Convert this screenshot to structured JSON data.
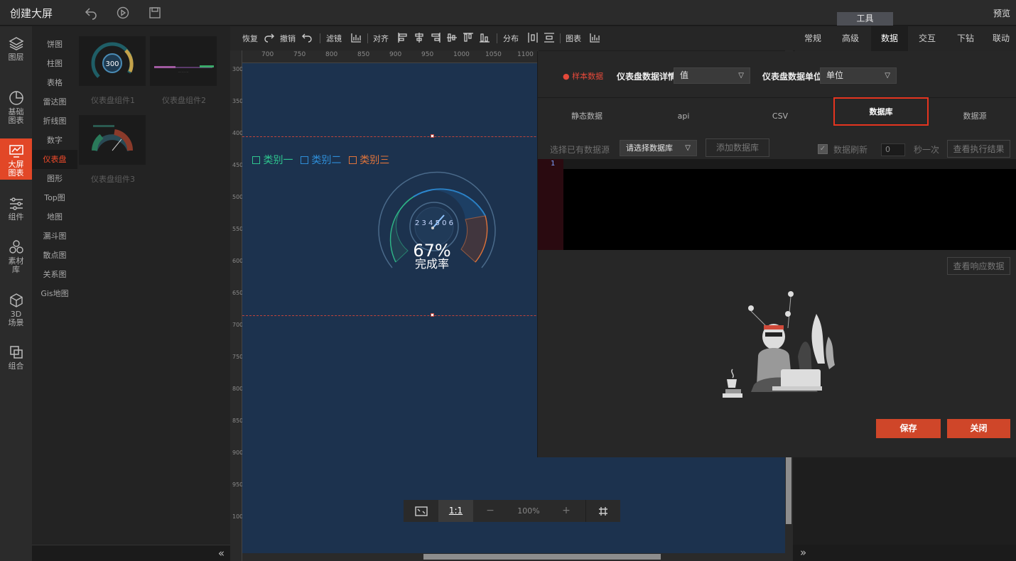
{
  "app": {
    "title": "创建大屏",
    "preview": "预览",
    "tools_tab": "工具"
  },
  "leftnav": [
    {
      "label": "图层",
      "icon": "layers-icon"
    },
    {
      "label": "基础图表",
      "icon": "pie-chart-icon"
    },
    {
      "label": "大屏图表",
      "icon": "screen-chart-icon",
      "active": true
    },
    {
      "label": "组件",
      "icon": "sliders-icon"
    },
    {
      "label": "素材库",
      "icon": "hexagons-icon"
    },
    {
      "label": "3D场景",
      "icon": "cube-icon"
    },
    {
      "label": "组合",
      "icon": "combine-icon"
    }
  ],
  "categories": [
    "饼图",
    "柱图",
    "表格",
    "雷达图",
    "折线图",
    "数字",
    "仪表盘",
    "图形",
    "Top图",
    "地图",
    "漏斗图",
    "散点图",
    "关系图",
    "Gis地图"
  ],
  "active_category": "仪表盘",
  "thumbnails": {
    "t1": {
      "label": "仪表盘组件1",
      "value": "300"
    },
    "t2": {
      "label": "仪表盘组件2"
    },
    "t3": {
      "label": "仪表盘组件3"
    }
  },
  "toolbar": {
    "restore": "恢复",
    "undo": "撤销",
    "filter": "滤镜",
    "align": "对齐",
    "distribute": "分布",
    "chart": "图表"
  },
  "ruler": {
    "top": [
      "700",
      "750",
      "800",
      "850",
      "900",
      "950",
      "1000",
      "1050",
      "1100"
    ],
    "left": [
      "300",
      "350",
      "400",
      "450",
      "500",
      "550",
      "600",
      "650",
      "700",
      "750",
      "800",
      "850",
      "900",
      "950",
      "1000"
    ]
  },
  "widget": {
    "legend": [
      "类别一",
      "类别二",
      "类别三"
    ],
    "legend_colors": [
      "#2ec58f",
      "#2e8ed8",
      "#e0743b"
    ],
    "center_digits": "2 3 4 5 0 6",
    "percent": "67%",
    "subtitle": "完成率"
  },
  "zoom": {
    "fit_label": "1:1",
    "level": "100%",
    "minus": "−",
    "plus": "+"
  },
  "right_tabs": [
    "常规",
    "高级",
    "数据",
    "交互",
    "下钻",
    "联动"
  ],
  "active_right_tab": "数据",
  "data_panel": {
    "sample_label": "● 样本数据",
    "detail_label": "仪表盘数据详情",
    "detail_value": "值",
    "unit_label": "仪表盘数据单位",
    "unit_value": "单位",
    "tabs": [
      "静态数据",
      "api",
      "CSV",
      "数据库",
      "数据源"
    ],
    "active_tab": "数据库",
    "existing_source_label": "选择已有数据源",
    "db_select_placeholder": "请选择数据库",
    "add_db": "添加数据库",
    "refresh_label": "数据刷新",
    "refresh_value": "0",
    "refresh_unit": "秒一次",
    "view_exec": "查看执行结果",
    "line_no": "1",
    "view_response": "查看响应数据",
    "save": "保存",
    "close": "关闭"
  }
}
